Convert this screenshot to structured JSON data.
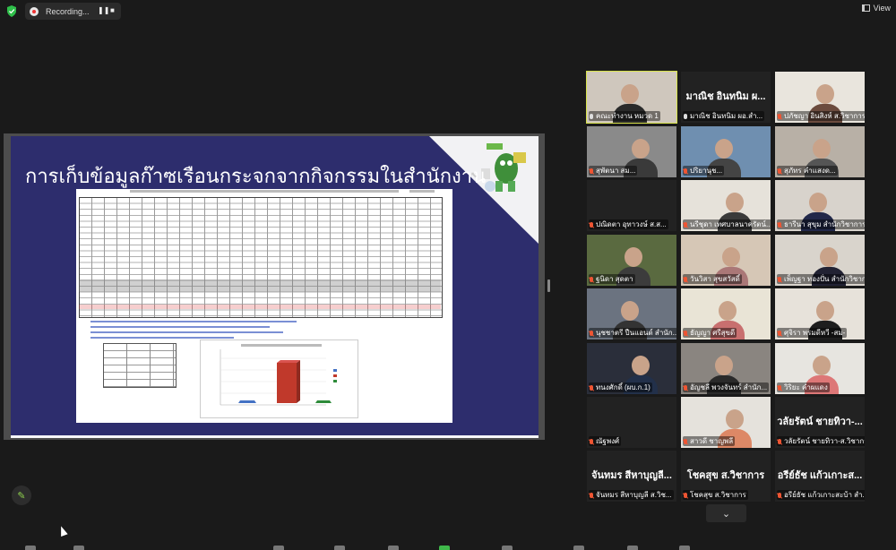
{
  "topbar": {
    "recording_label": "Recording...",
    "pause_symbol": "❚❚",
    "stop_symbol": "■",
    "view_label": "View"
  },
  "shared_screen": {
    "slide_title": "การเก็บข้อมูลก๊าซเรือนกระจกจากกิจกรรมในสำนักงาน",
    "accent_color": "#2d2d6d"
  },
  "gallery": {
    "participants": [
      {
        "name": "คณะทำงาน หมวด 1",
        "muted": false,
        "video": true,
        "active": true
      },
      {
        "name": "มาณิช อินทนิม ผอ.สำ...",
        "muted": false,
        "video": false,
        "display_name": "มาณิช อินทนิม ผ..."
      },
      {
        "name": "ปภัชญา อินสิงห์ ส.วิชาการ",
        "muted": true,
        "video": true
      },
      {
        "name": "สุพัตนา สม...",
        "muted": true,
        "video": true
      },
      {
        "name": "ปริยานุช...",
        "muted": true,
        "video": true
      },
      {
        "name": "สุภัทร คำแสงด...",
        "muted": true,
        "video": true
      },
      {
        "name": "ปณิดตา อุทาวงษ์ ส.ส...",
        "muted": true,
        "video": false
      },
      {
        "name": "นรีชุดา เทศบาลนาครัตน์...",
        "muted": true,
        "video": true
      },
      {
        "name": "ธารีนา สุขุม สำนักวิชาการ",
        "muted": true,
        "video": true
      },
      {
        "name": "ฐนิดา สุดตา",
        "muted": true,
        "video": true
      },
      {
        "name": "วันวิสา สุขสวัสดิ์",
        "muted": true,
        "video": true
      },
      {
        "name": "เพ็ญฐา ทองปั่น สำนักวิชาการ",
        "muted": true,
        "video": true
      },
      {
        "name": "นุชชาตรี ปืนแอนด์ สำนัก...",
        "muted": true,
        "video": true
      },
      {
        "name": "ธัญญา ศรีสุขดี",
        "muted": true,
        "video": true
      },
      {
        "name": "ศุจิรา พรมดีหวี -สม-",
        "muted": true,
        "video": true
      },
      {
        "name": "ทนงศักดิ์ (ผบ.ก.1)",
        "muted": true,
        "video": true
      },
      {
        "name": "อัญชลี พวงจันทร์ สำนัก...",
        "muted": true,
        "video": true
      },
      {
        "name": "วิริยะ คำผแดง",
        "muted": true,
        "video": true
      },
      {
        "name": "ณัฐพงศ์",
        "muted": true,
        "video": false
      },
      {
        "name": "สาวดี ชาญพลี",
        "muted": true,
        "video": true
      },
      {
        "name": "วลัยรัตน์ ชายทิวา-ส.วิชาการ",
        "muted": true,
        "video": false,
        "display_name": "วลัยรัตน์ ชายทิวา-..."
      },
      {
        "name": "จันทมร สีหาบุญลี ส.วิช...",
        "muted": true,
        "video": false,
        "display_name": "จันทมร สีหาบุญลี..."
      },
      {
        "name": "โชคสุข ส.วิชาการ",
        "muted": true,
        "video": false,
        "display_name": "โชคสุข ส.วิชาการ"
      },
      {
        "name": "อรีย์ธัช แก้วเกาะสะบ้า สำ...",
        "muted": true,
        "video": false,
        "display_name": "อรีย์ธัช แก้วเกาะส..."
      }
    ],
    "more_symbol": "⌄"
  },
  "icons": {
    "shield": "shield-icon",
    "pen": "pen-icon",
    "view": "view-icon"
  }
}
